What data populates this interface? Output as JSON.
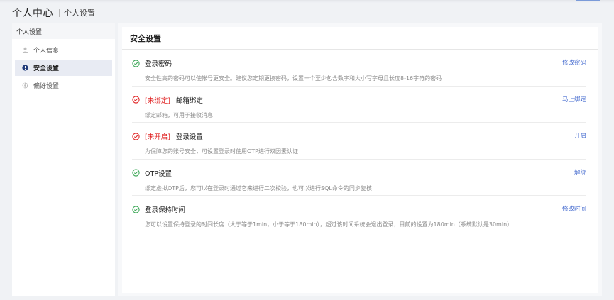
{
  "header": {
    "title": "个人中心",
    "breadcrumb": "个人设置"
  },
  "sidebar": {
    "title": "个人设置",
    "items": [
      {
        "label": "个人信息",
        "icon": "user-icon"
      },
      {
        "label": "安全设置",
        "icon": "alert-circle-icon",
        "active": true
      },
      {
        "label": "偏好设置",
        "icon": "gear-icon"
      }
    ]
  },
  "panel": {
    "title": "安全设置",
    "items": [
      {
        "status": "ok",
        "tag": "",
        "title": "登录密码",
        "action": "修改密码",
        "desc": "安全性高的密码可以使帐号更安全。建议您定期更换密码，设置一个至少包含数字和大小写字母且长度8-16字符的密码"
      },
      {
        "status": "warn",
        "tag": "[未绑定]",
        "title": "邮箱绑定",
        "action": "马上绑定",
        "desc": "绑定邮箱，可用于接收消息"
      },
      {
        "status": "warn",
        "tag": "[未开启]",
        "title": "登录设置",
        "action": "开启",
        "desc": "为保障您的账号安全，可设置登录时使用OTP进行双因素认证"
      },
      {
        "status": "ok",
        "tag": "",
        "title": "OTP设置",
        "action": "解绑",
        "desc": "绑定虚拟OTP后，您可以在登录时通过它来进行二次校验，也可以进行SQL命令的同步复核"
      },
      {
        "status": "ok",
        "tag": "",
        "title": "登录保持时间",
        "action": "修改时间",
        "desc": "您可以设置保持登录的时间长度（大于等于1min，小于等于180min），超过该时间系统会退出登录，目前的设置为180min（系统默认是30min）"
      }
    ]
  },
  "colors": {
    "ok": "#3aa655",
    "warn": "#e02424",
    "link": "#4a6fd0"
  }
}
